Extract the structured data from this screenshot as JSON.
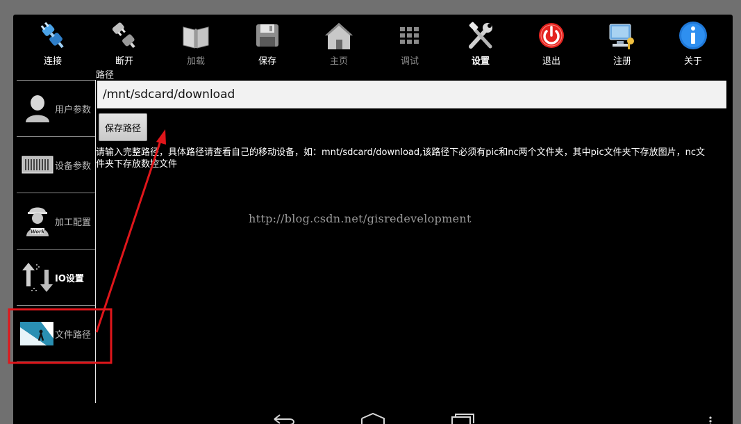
{
  "toolbar": {
    "items": [
      {
        "label": "连接",
        "icon": "plug-connect-icon",
        "state": "enabled"
      },
      {
        "label": "断开",
        "icon": "plug-disconnect-icon",
        "state": "enabled"
      },
      {
        "label": "加载",
        "icon": "open-book-icon",
        "state": "disabled"
      },
      {
        "label": "保存",
        "icon": "floppy-disk-icon",
        "state": "enabled"
      },
      {
        "label": "主页",
        "icon": "home-icon",
        "state": "disabled"
      },
      {
        "label": "调试",
        "icon": "grid-icon",
        "state": "disabled"
      },
      {
        "label": "设置",
        "icon": "tools-icon",
        "state": "selected"
      },
      {
        "label": "退出",
        "icon": "power-icon",
        "state": "enabled"
      },
      {
        "label": "注册",
        "icon": "computer-key-icon",
        "state": "enabled"
      },
      {
        "label": "关于",
        "icon": "info-icon",
        "state": "enabled"
      }
    ]
  },
  "sidebar": {
    "items": [
      {
        "label": "用户参数",
        "icon": "user-icon"
      },
      {
        "label": "设备参数",
        "icon": "device-rack-icon"
      },
      {
        "label": "加工配置",
        "icon": "worker-icon"
      },
      {
        "label": "IO设置",
        "icon": "io-arrows-icon"
      },
      {
        "label": "文件路径",
        "icon": "file-path-icon"
      }
    ],
    "active_index": 4
  },
  "main": {
    "path_heading": "路径",
    "path_value": "/mnt/sdcard/download",
    "save_button": "保存路径",
    "hint": "请输入完整路径，具体路径请查看自己的移动设备，如：mnt/sdcard/download,该路径下必须有pic和nc两个文件夹，其中pic文件夹下存放图片，nc文件夹下存放数控文件",
    "watermark": "http://blog.csdn.net/gisredevelopment"
  },
  "navbar": {
    "buttons": [
      "back",
      "home",
      "recent-apps",
      "menu"
    ]
  },
  "colors": {
    "annotation": "#e0161b",
    "background": "#000000",
    "input_background": "#f2f2f2"
  }
}
